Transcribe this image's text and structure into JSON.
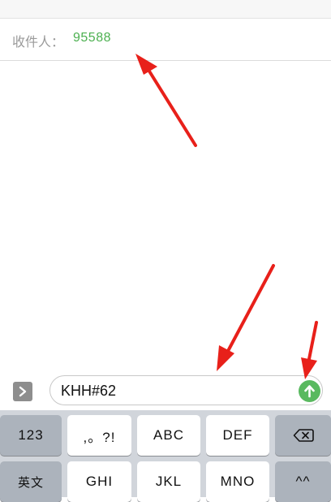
{
  "recipient": {
    "label": "收件人：",
    "value": "95588"
  },
  "composer": {
    "text": "KHH#62",
    "send_icon": "arrow-up-icon",
    "expand_icon": "chevron-right-icon"
  },
  "keyboard": {
    "row1": [
      "123",
      ",。?!",
      "ABC",
      "DEF"
    ],
    "row2": [
      "英文",
      "GHI",
      "JKL",
      "MNO",
      "^^"
    ],
    "backspace_icon": "backspace-icon"
  },
  "colors": {
    "accent": "#4cb050",
    "send_button": "#59b95f",
    "annotation_arrow": "#e8201a"
  }
}
